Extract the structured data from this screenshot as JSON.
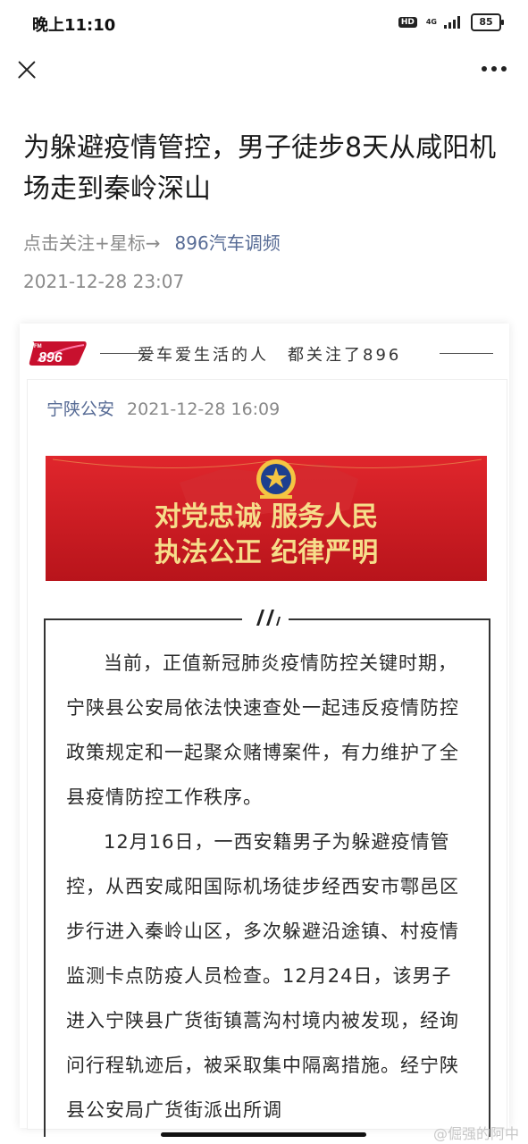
{
  "status_bar": {
    "time": "晚上11:10",
    "hd": "HD",
    "network": "4G",
    "battery": "85"
  },
  "icons": {
    "close": "close-icon",
    "more": "more-icon",
    "quote": "quote-icon",
    "police_emblem": "police-emblem-icon"
  },
  "article": {
    "title": "为躲避疫情管控，男子徒步8天从咸阳机场走到秦岭深山",
    "follow_prompt": "点击关注+星标→",
    "account_name": "896汽车调频",
    "publish_date": "2021-12-28 23:07"
  },
  "brand": {
    "logo_fm": "FM",
    "logo_number": "896",
    "slogan": "爱车爱生活的人　都关注了896"
  },
  "source": {
    "name": "宁陕公安",
    "date": "2021-12-28 16:09"
  },
  "banner": {
    "line1": "对党忠诚 服务人民",
    "line2": "执法公正 纪律严明"
  },
  "body": {
    "p1": "当前，正值新冠肺炎疫情防控关键时期，宁陕县公安局依法快速查处一起违反疫情防控政策规定和一起聚众赌博案件，有力维护了全县疫情防控工作秩序。",
    "p2": "12月16日，一西安籍男子为躲避疫情管控，从西安咸阳国际机场徒步经西安市鄠邑区步行进入秦岭山区，多次躲避沿途镇、村疫情监测卡点防疫人员检查。12月24日，该男子进入宁陕县广货街镇蒿沟村境内被发现，经询问行程轨迹后，被采取集中隔离措施。经宁陕县公安局广货街派出所调"
  },
  "watermark": "@倔强的阿中",
  "colors": {
    "link": "#576b95",
    "meta_gray": "#8a8a8a",
    "banner_red": "#d02027",
    "banner_gold": "#f6dd8a",
    "logo_red": "#c8102e"
  }
}
